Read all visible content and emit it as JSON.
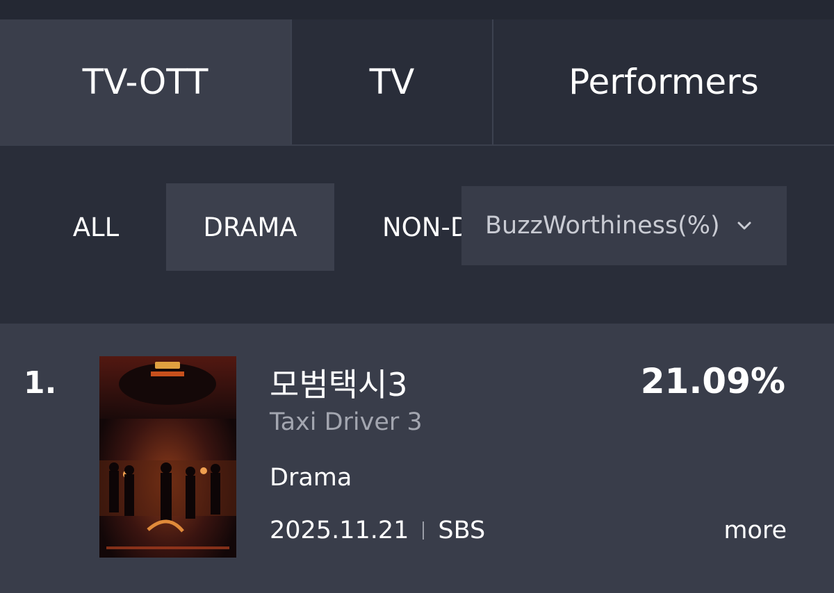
{
  "tabs": [
    {
      "label": "TV-OTT",
      "active": true
    },
    {
      "label": "TV",
      "active": false
    },
    {
      "label": "Performers",
      "active": false
    }
  ],
  "filters": {
    "all": "ALL",
    "drama": "DRAMA",
    "non_drama": "NON-DRAMA",
    "active": "DRAMA"
  },
  "sort": {
    "label": "BuzzWorthiness(%)"
  },
  "list": [
    {
      "rank": "1.",
      "title_ko": "모범택시3",
      "title_en": "Taxi Driver 3",
      "genre": "Drama",
      "date": "2025.11.21",
      "network": "SBS",
      "score": "21.09%",
      "more_label": "more"
    }
  ],
  "colors": {
    "background": "#262a36",
    "active_tab": "#3a3e4b",
    "row_bg": "#393d4a",
    "muted_text": "#a3a6b0"
  }
}
